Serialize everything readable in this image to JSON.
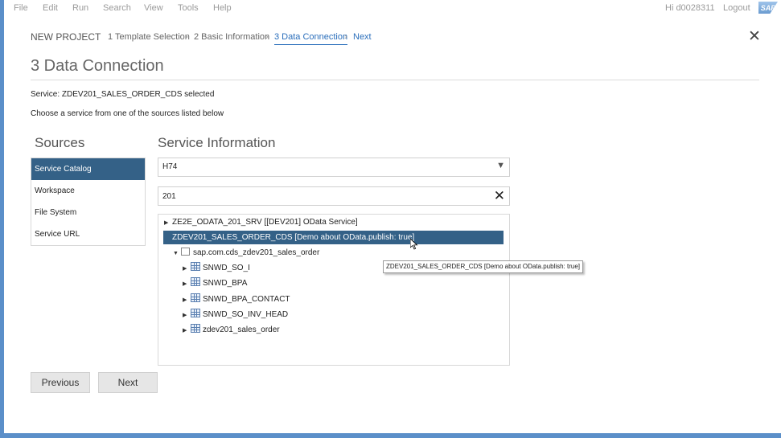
{
  "menu": {
    "items": [
      "File",
      "Edit",
      "Run",
      "Search",
      "View",
      "Tools",
      "Help"
    ],
    "user_greeting": "Hi d0028311",
    "logout": "Logout",
    "logo": "SAP"
  },
  "wizard": {
    "title": "NEW PROJECT",
    "steps": [
      {
        "label": "1 Template Selection",
        "state": "done"
      },
      {
        "label": "2 Basic Information",
        "state": "done"
      },
      {
        "label": "3 Data Connection",
        "state": "active"
      },
      {
        "label": "Next",
        "state": "link"
      }
    ],
    "separator": "›",
    "close_icon": "close-icon"
  },
  "page": {
    "title": "3 Data Connection",
    "status": "Service: ZDEV201_SALES_ORDER_CDS selected",
    "hint": "Choose a service from one of the sources listed below"
  },
  "sources": {
    "title": "Sources",
    "items": [
      "Service Catalog",
      "Workspace",
      "File System",
      "Service URL"
    ],
    "selected": "Service Catalog"
  },
  "service_info": {
    "title": "Service Information",
    "system_select": {
      "value": "H74",
      "icon": "dropdown-arrow-icon"
    },
    "search": {
      "value": "201",
      "icon": "clear-icon"
    },
    "tree": [
      {
        "label": "ZE2E_ODATA_201_SRV [[DEV201] OData Service]",
        "expanded": false,
        "selected": false
      },
      {
        "label": "ZDEV201_SALES_ORDER_CDS [Demo about OData.publish: true]",
        "expanded": true,
        "selected": true
      },
      {
        "label": "sap.com.cds_zdev201_sales_order",
        "expanded": true,
        "icon": "package-icon"
      },
      {
        "label": "SNWD_SO_I",
        "icon": "table-icon"
      },
      {
        "label": "SNWD_BPA",
        "icon": "table-icon"
      },
      {
        "label": "SNWD_BPA_CONTACT",
        "icon": "table-icon"
      },
      {
        "label": "SNWD_SO_INV_HEAD",
        "icon": "table-icon"
      },
      {
        "label": "zdev201_sales_order",
        "icon": "table-icon"
      }
    ],
    "tooltip": "ZDEV201_SALES_ORDER_CDS [Demo about OData.publish: true]"
  },
  "footer": {
    "previous": "Previous",
    "next": "Next"
  },
  "colors": {
    "selection": "#346187",
    "link": "#2a6ebb",
    "frame": "#5b8fc9"
  }
}
